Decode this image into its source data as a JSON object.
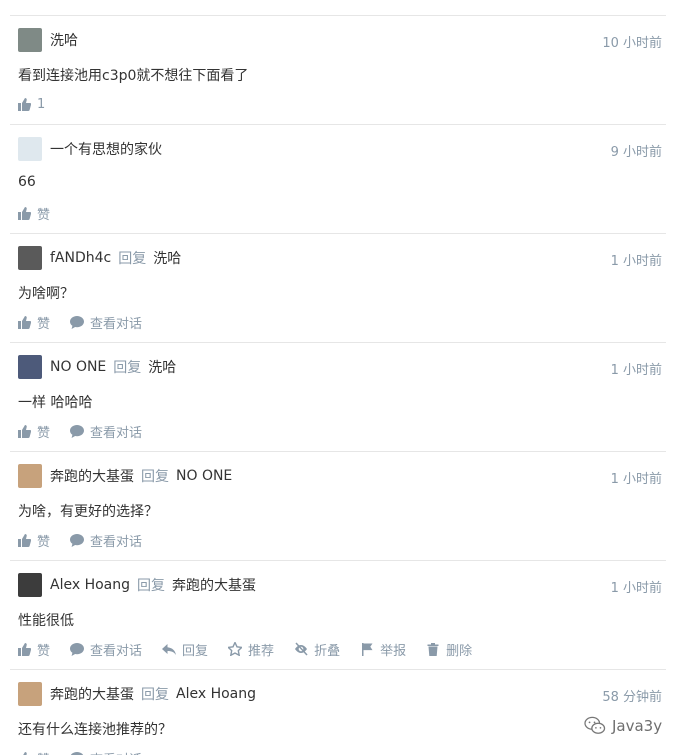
{
  "comments": [
    {
      "author": "洗哈",
      "reply_word": "",
      "reply_to": "",
      "time": "10 小时前",
      "content": "看到连接池用c3p0就不想往下面看了",
      "avatar_color": "#7f8a86",
      "actions": [
        {
          "icon": "thumbs-up-icon",
          "label": "1"
        }
      ]
    },
    {
      "author": "一个有思想的家伙",
      "reply_word": "",
      "reply_to": "",
      "time": "9 小时前",
      "content": "66",
      "avatar_color": "#dfe8ee",
      "actions": [
        {
          "icon": "thumbs-up-icon",
          "label": "赞"
        }
      ]
    },
    {
      "author": "fANDh4c",
      "reply_word": "回复",
      "reply_to": "洗哈",
      "time": "1 小时前",
      "content": "为啥啊？",
      "avatar_color": "#5a5a5a",
      "actions": [
        {
          "icon": "thumbs-up-icon",
          "label": "赞"
        },
        {
          "icon": "speech-bubble-icon",
          "label": "查看对话"
        }
      ]
    },
    {
      "author": "NO ONE",
      "reply_word": "回复",
      "reply_to": "洗哈",
      "time": "1 小时前",
      "content": "一样 哈哈哈",
      "avatar_color": "#4d5a7a",
      "actions": [
        {
          "icon": "thumbs-up-icon",
          "label": "赞"
        },
        {
          "icon": "speech-bubble-icon",
          "label": "查看对话"
        }
      ]
    },
    {
      "author": "奔跑的大基蛋",
      "reply_word": "回复",
      "reply_to": "NO ONE",
      "time": "1 小时前",
      "content": "为啥，有更好的选择？",
      "avatar_color": "#c7a27c",
      "actions": [
        {
          "icon": "thumbs-up-icon",
          "label": "赞"
        },
        {
          "icon": "speech-bubble-icon",
          "label": "查看对话"
        }
      ]
    },
    {
      "author": "Alex Hoang",
      "reply_word": "回复",
      "reply_to": "奔跑的大基蛋",
      "time": "1 小时前",
      "content": "性能很低",
      "avatar_color": "#3c3c3c",
      "actions": [
        {
          "icon": "thumbs-up-icon",
          "label": "赞"
        },
        {
          "icon": "speech-bubble-icon",
          "label": "查看对话"
        },
        {
          "icon": "reply-arrow-icon",
          "label": "回复"
        },
        {
          "icon": "star-icon",
          "label": "推荐"
        },
        {
          "icon": "eye-slash-icon",
          "label": "折叠"
        },
        {
          "icon": "flag-icon",
          "label": "举报"
        },
        {
          "icon": "trash-icon",
          "label": "删除"
        }
      ]
    },
    {
      "author": "奔跑的大基蛋",
      "reply_word": "回复",
      "reply_to": "Alex Hoang",
      "time": "58 分钟前",
      "content": "还有什么连接池推荐的？",
      "avatar_color": "#c7a27c",
      "actions": [
        {
          "icon": "thumbs-up-icon",
          "label": "赞"
        },
        {
          "icon": "speech-bubble-icon",
          "label": "查看对话"
        }
      ]
    }
  ],
  "watermark": {
    "icon": "wechat-logo-icon",
    "text": "Java3y"
  }
}
